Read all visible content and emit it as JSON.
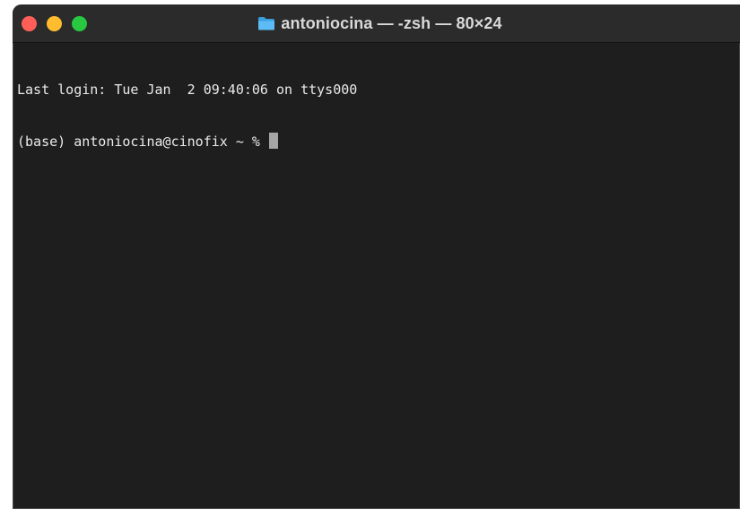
{
  "window": {
    "title": "antoniocina — -zsh — 80×24",
    "folder_icon": "folder-icon"
  },
  "terminal": {
    "lines": [
      "Last login: Tue Jan  2 09:40:06 on ttys000",
      "(base) antoniocina@cinofix ~ % "
    ]
  },
  "colors": {
    "background": "#1e1e1e",
    "titlebar": "#2b2b2b",
    "close": "#ff5f57",
    "minimize": "#febc2e",
    "zoom": "#28c840",
    "folder": "#4fb3ef"
  }
}
